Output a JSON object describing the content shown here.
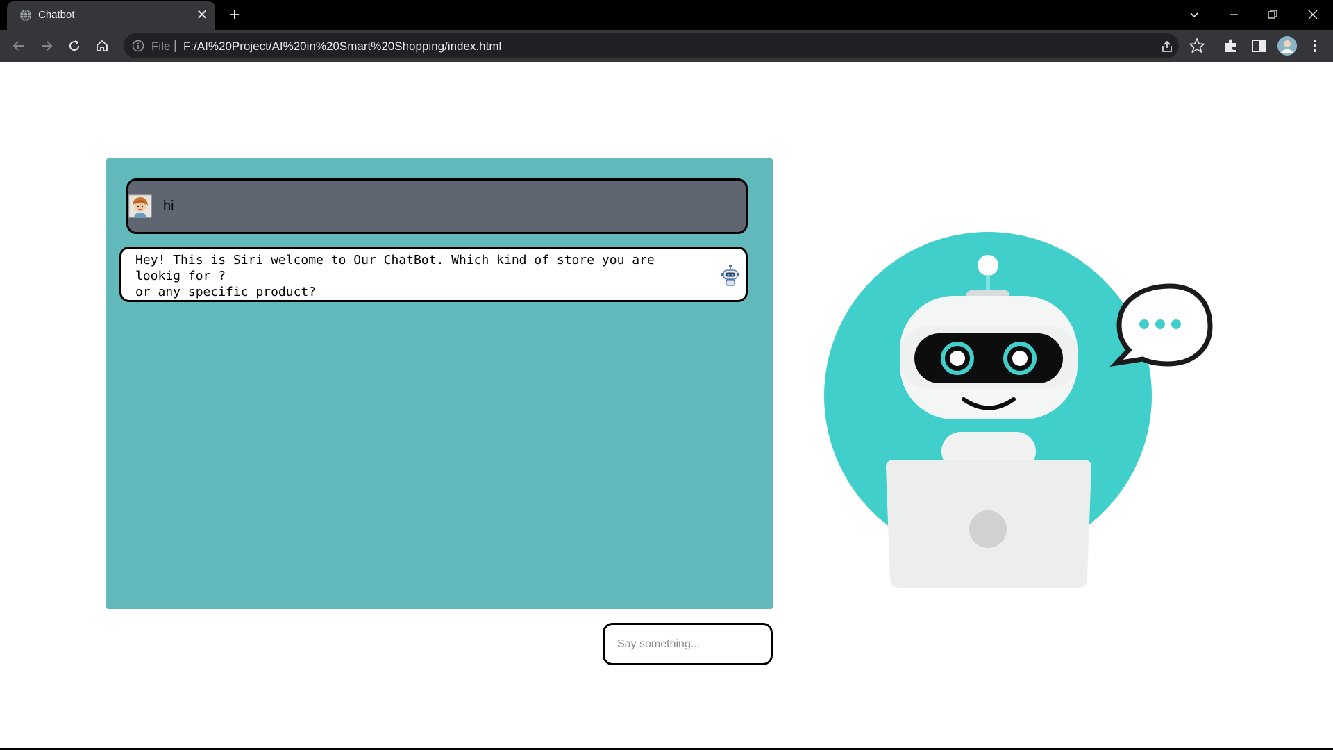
{
  "browser": {
    "tab_title": "Chatbot",
    "tab_close": "✕",
    "new_tab": "+",
    "scheme_label": "File",
    "separator": "|",
    "url": "F:/AI%20Project/AI%20in%20Smart%20Shopping/index.html",
    "window_controls": {
      "minimize": "—",
      "restore": "❐",
      "close": "✕",
      "tab_search": "⌄"
    },
    "icons": [
      "back-arrow-icon",
      "forward-arrow-icon",
      "reload-icon",
      "home-icon",
      "info-icon",
      "share-icon",
      "star-icon",
      "extensions-icon",
      "side-panel-icon",
      "profile-avatar",
      "menu-icon"
    ]
  },
  "chat": {
    "messages": [
      {
        "sender": "user",
        "text": "hi"
      },
      {
        "sender": "bot",
        "text": "Hey! This is Siri welcome to Our ChatBot. Which kind of store you are\nlookig for ?\nor any specific product?"
      }
    ]
  },
  "input": {
    "placeholder": "Say something...",
    "value": ""
  },
  "colors": {
    "chat_panel": "#61b9bc",
    "user_bubble": "#5f6672",
    "bot_bubble": "#ffffff",
    "illustration_circle": "#41cfcb",
    "chrome_dark": "#35363a"
  }
}
